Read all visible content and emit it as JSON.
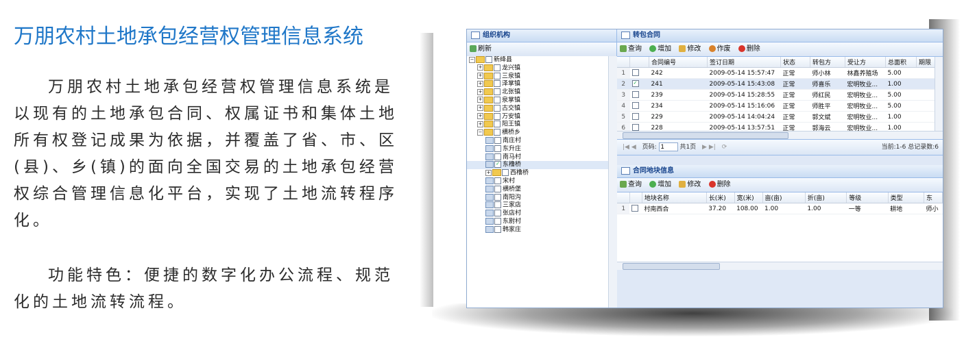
{
  "title": "万朋农村土地承包经营权管理信息系统",
  "paragraph1": "万朋农村土地承包经营权管理信息系统是以现有的土地承包合同、权属证书和集体土地所有权登记成果为依据，并覆盖了省、市、区(县)、乡(镇)的面向全国交易的土地承包经营权综合管理信息化平台，实现了土地流转程序化。",
  "paragraph2": "功能特色：便捷的数字化办公流程、规范化的土地流转流程。",
  "app": {
    "org_panel": {
      "title": "组织机构",
      "refresh_label": "刷新",
      "tree": [
        {
          "label": "新绛县",
          "level": 0,
          "type": "folder",
          "expanded": true
        },
        {
          "label": "龙兴镇",
          "level": 1,
          "type": "folder"
        },
        {
          "label": "三泉镇",
          "level": 1,
          "type": "folder"
        },
        {
          "label": "泽掌镇",
          "level": 1,
          "type": "folder"
        },
        {
          "label": "北张镇",
          "level": 1,
          "type": "folder"
        },
        {
          "label": "泉掌镇",
          "level": 1,
          "type": "folder"
        },
        {
          "label": "古交镇",
          "level": 1,
          "type": "folder"
        },
        {
          "label": "万安镇",
          "level": 1,
          "type": "folder"
        },
        {
          "label": "阳王镇",
          "level": 1,
          "type": "folder"
        },
        {
          "label": "横桥乡",
          "level": 1,
          "type": "folder",
          "expanded": true
        },
        {
          "label": "南庄村",
          "level": 2,
          "type": "leaf"
        },
        {
          "label": "东升庄",
          "level": 2,
          "type": "leaf"
        },
        {
          "label": "南马村",
          "level": 2,
          "type": "leaf"
        },
        {
          "label": "东橹桥",
          "level": 2,
          "type": "leaf",
          "checked": true,
          "selected": true
        },
        {
          "label": "西橹桥",
          "level": 2,
          "type": "folder"
        },
        {
          "label": "宋村",
          "level": 2,
          "type": "leaf"
        },
        {
          "label": "横桥堡",
          "level": 2,
          "type": "leaf"
        },
        {
          "label": "南阳沟",
          "level": 2,
          "type": "leaf"
        },
        {
          "label": "三家店",
          "level": 2,
          "type": "leaf"
        },
        {
          "label": "张店村",
          "level": 2,
          "type": "leaf"
        },
        {
          "label": "东尉村",
          "level": 2,
          "type": "leaf"
        },
        {
          "label": "韩家庄",
          "level": 2,
          "type": "leaf"
        }
      ]
    },
    "contract_panel": {
      "title": "转包合同",
      "toolbar": {
        "query": "查询",
        "add": "增加",
        "edit": "修改",
        "void": "作废",
        "delete": "删除"
      },
      "columns": [
        "合同编号",
        "签订日期",
        "状态",
        "转包方",
        "受让方",
        "总面积",
        "期限"
      ],
      "rows": [
        {
          "no": "1",
          "checked": false,
          "id": "242",
          "date": "2009-05-14 15:57:47",
          "status": "正常",
          "from": "师小林",
          "to": "林鑫养殖场",
          "area": "5.00"
        },
        {
          "no": "2",
          "checked": true,
          "id": "241",
          "date": "2009-05-14 15:43:08",
          "status": "正常",
          "from": "师喜乐",
          "to": "宏明牧业...",
          "area": "1.00"
        },
        {
          "no": "3",
          "checked": false,
          "id": "239",
          "date": "2009-05-14 15:28:55",
          "status": "正常",
          "from": "师红民",
          "to": "宏明牧业...",
          "area": "5.00"
        },
        {
          "no": "4",
          "checked": false,
          "id": "234",
          "date": "2009-05-14 15:16:06",
          "status": "正常",
          "from": "师胜平",
          "to": "宏明牧业...",
          "area": "5.00"
        },
        {
          "no": "5",
          "checked": false,
          "id": "229",
          "date": "2009-05-14 14:04:24",
          "status": "正常",
          "from": "郭文斌",
          "to": "宏明牧业...",
          "area": "1.00"
        },
        {
          "no": "6",
          "checked": false,
          "id": "228",
          "date": "2009-05-14 13:57:51",
          "status": "正常",
          "from": "郭海云",
          "to": "宏明牧业...",
          "area": "1.00"
        }
      ],
      "pager": {
        "page_label": "页码:",
        "page_value": "1",
        "total_pages": "共1页",
        "summary": "当前:1-6 总记录数:6"
      }
    },
    "plot_panel": {
      "title": "合同地块信息",
      "toolbar": {
        "query": "查询",
        "add": "增加",
        "edit": "修改",
        "delete": "删除"
      },
      "columns": [
        "地块名称",
        "长(米)",
        "宽(米)",
        "亩(亩)",
        "折(亩)",
        "等级",
        "类型",
        "东"
      ],
      "rows": [
        {
          "no": "1",
          "name": "村南西合",
          "length": "37.20",
          "width": "108.00",
          "mu": "1.00",
          "zhe": "1.00",
          "grade": "一等",
          "type": "耕地",
          "east": "师小"
        }
      ]
    }
  }
}
